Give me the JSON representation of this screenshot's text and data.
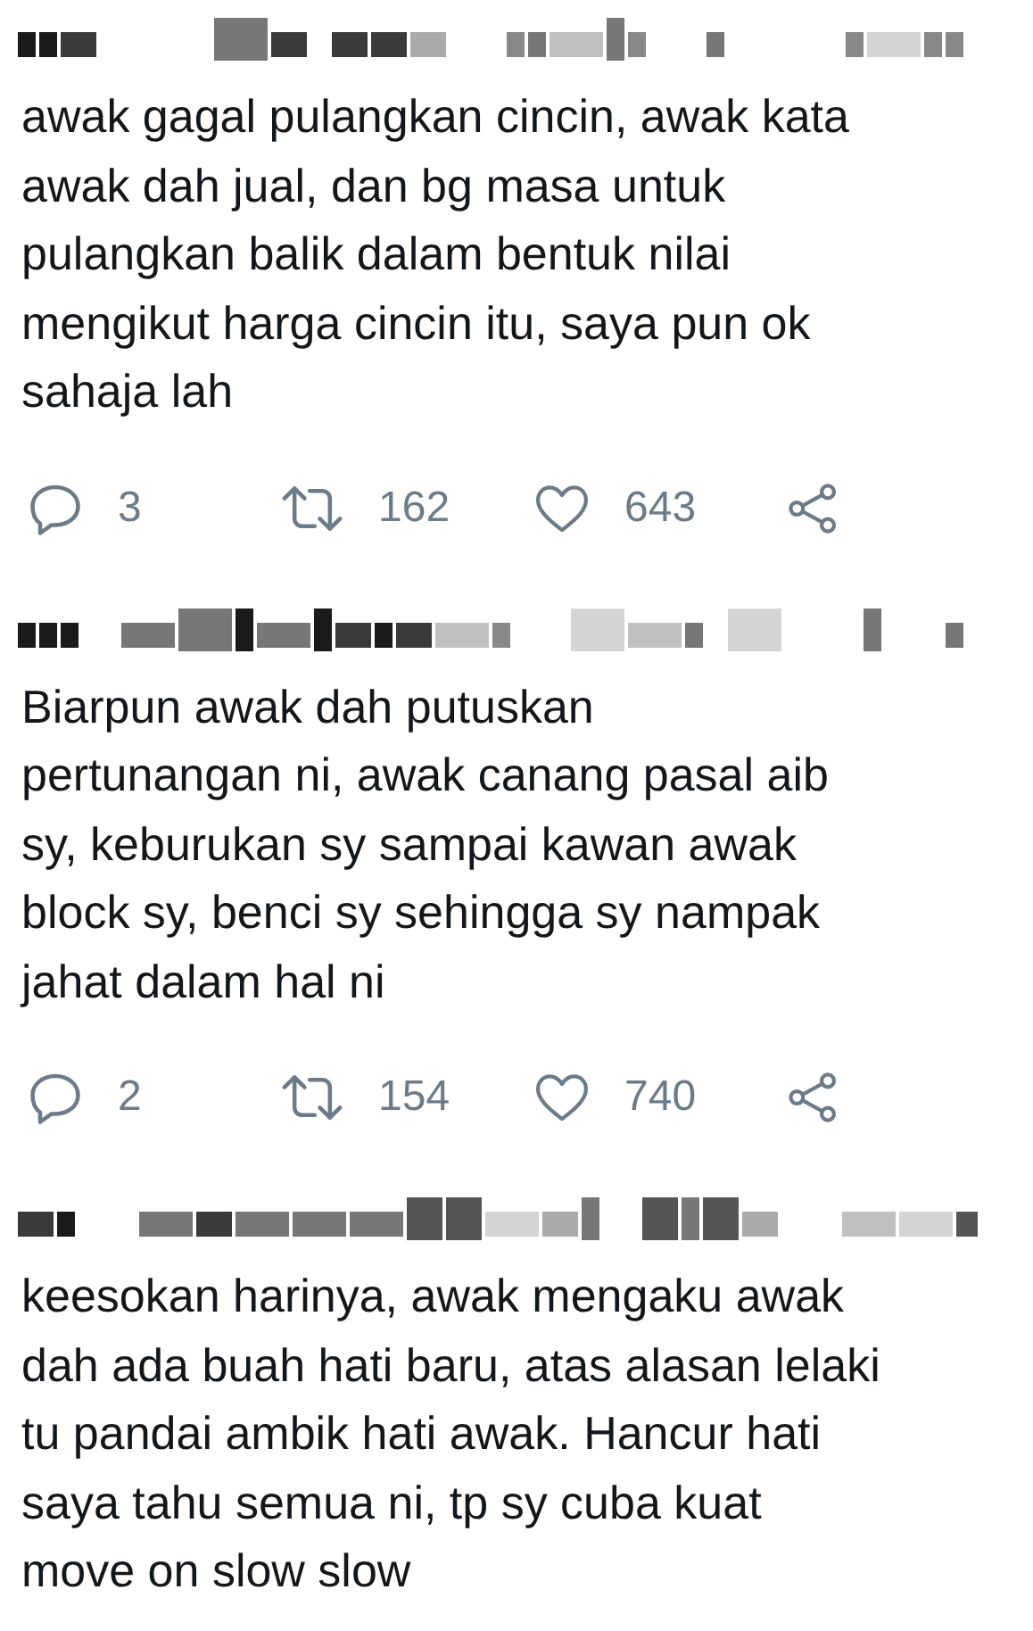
{
  "tweets": [
    {
      "header": {
        "pixelated": true
      },
      "text": "awak gagal pulangkan cincin, awak kata\nawak dah jual, dan bg masa untuk\npulangkan balik dalam bentuk nilai\nmengikut harga cincin itu, saya pun ok\nsahaja lah",
      "replies": "3",
      "retweets": "162",
      "likes": "643"
    },
    {
      "header": {
        "pixelated": true
      },
      "text": "Biarpun awak dah putuskan\npertunangan ni, awak canang pasal aib\nsy, keburukan sy sampai kawan awak\nblock sy, benci sy sehingga sy nampak\njahat dalam hal ni",
      "replies": "2",
      "retweets": "154",
      "likes": "740"
    },
    {
      "header": {
        "pixelated": true
      },
      "text": "keesokan harinya, awak mengaku awak\ndah ada buah hati baru, atas alasan lelaki\ntu pandai ambik hati awak. Hancur hati\nsaya tahu semua ni, tp sy cuba kuat\nmove on slow slow"
    }
  ]
}
